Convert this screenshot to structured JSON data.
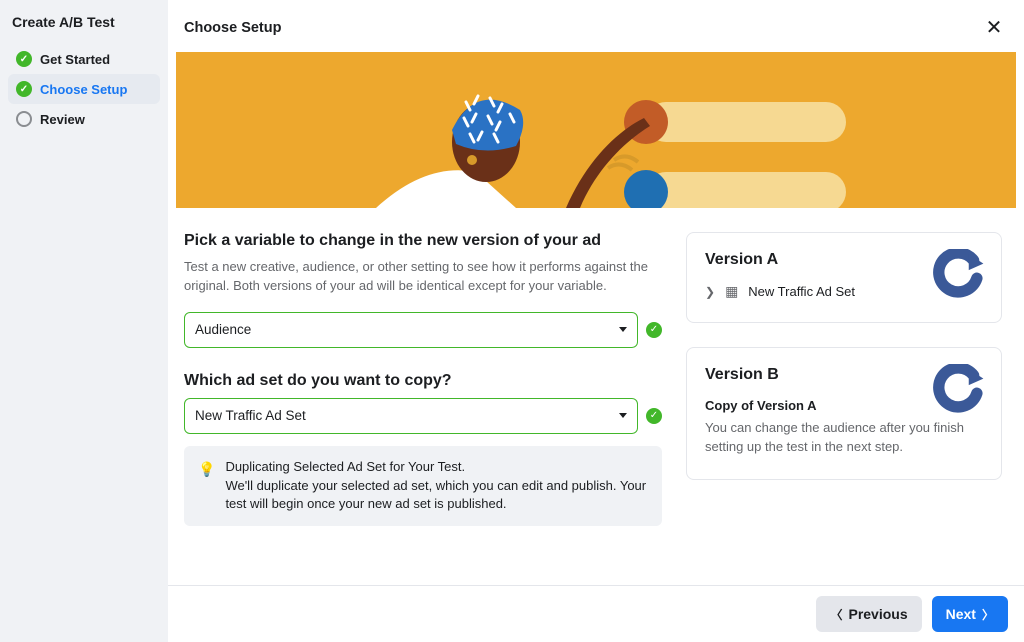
{
  "sidebar": {
    "title": "Create A/B Test",
    "steps": {
      "getStarted": {
        "label": "Get Started"
      },
      "chooseSetup": {
        "label": "Choose Setup"
      },
      "review": {
        "label": "Review"
      }
    }
  },
  "header": {
    "title": "Choose Setup"
  },
  "left": {
    "heading": "Pick a variable to change in the new version of your ad",
    "description": "Test a new creative, audience, or other setting to see how it performs against the original. Both versions of your ad will be identical except for your variable.",
    "variableSelect": {
      "value": "Audience"
    },
    "heading2": "Which ad set do you want to copy?",
    "adsetSelect": {
      "value": "New Traffic Ad Set"
    },
    "tip": {
      "title": "Duplicating Selected Ad Set for Your Test.",
      "body": "We'll duplicate your selected ad set, which you can edit and publish. Your test will begin once your new ad set is published."
    }
  },
  "right": {
    "versionA": {
      "title": "Version A",
      "item": "New Traffic Ad Set"
    },
    "versionB": {
      "title": "Version B",
      "sub": "Copy of Version A",
      "desc": "You can change the audience after you finish setting up the test in the next step."
    }
  },
  "footer": {
    "prev": "Previous",
    "next": "Next"
  }
}
